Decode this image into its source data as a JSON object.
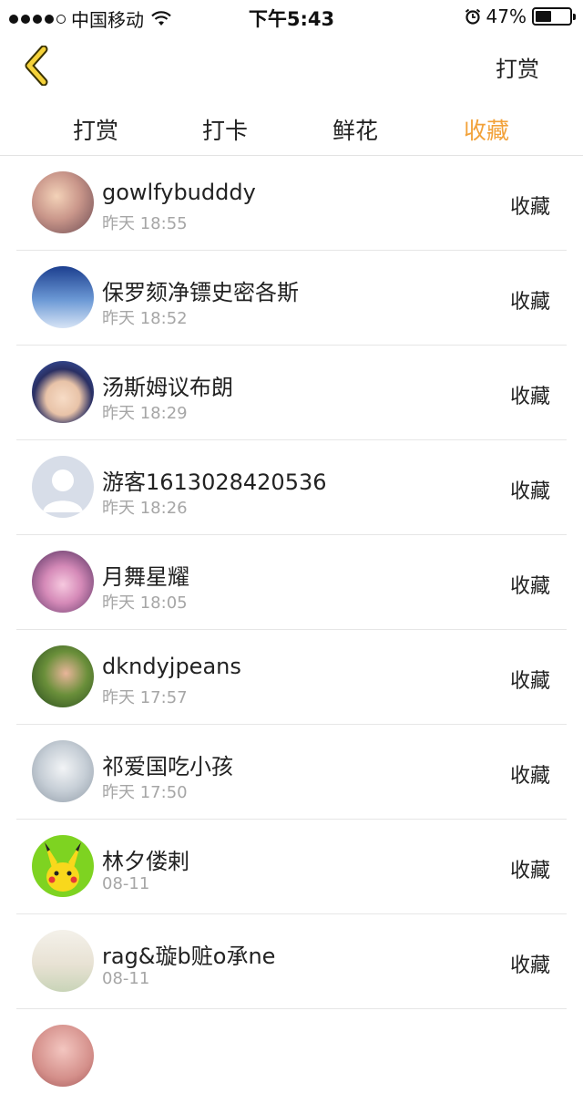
{
  "status_bar": {
    "carrier": "中国移动",
    "time": "下午5:43",
    "battery_text": "47%",
    "battery_level": 0.47
  },
  "nav": {
    "right_label": "打赏"
  },
  "tabs": [
    {
      "label": "打赏",
      "active": false
    },
    {
      "label": "打卡",
      "active": false
    },
    {
      "label": "鲜花",
      "active": false
    },
    {
      "label": "收藏",
      "active": true
    }
  ],
  "accent_color": "#f2a23a",
  "items": [
    {
      "name": "gowlfybudddy",
      "time": "昨天 18:55",
      "action": "收藏"
    },
    {
      "name": "保罗颏净镖史密各斯",
      "time": "昨天 18:52",
      "action": "收藏"
    },
    {
      "name": "汤斯姆议布朗",
      "time": "昨天 18:29",
      "action": "收藏"
    },
    {
      "name": "游客1613028420536",
      "time": "昨天 18:26",
      "action": "收藏"
    },
    {
      "name": "月舞星耀",
      "time": "昨天 18:05",
      "action": "收藏"
    },
    {
      "name": "dkndyjpeans",
      "time": "昨天 17:57",
      "action": "收藏"
    },
    {
      "name": "祁爱国吃小孩",
      "time": "昨天 17:50",
      "action": "收藏"
    },
    {
      "name": "林夕偻剌",
      "time": "08-11",
      "action": "收藏"
    },
    {
      "name": "rag&璇b赃o承ne",
      "time": "08-11",
      "action": "收藏"
    },
    {
      "name": "",
      "time": "",
      "action": ""
    }
  ]
}
